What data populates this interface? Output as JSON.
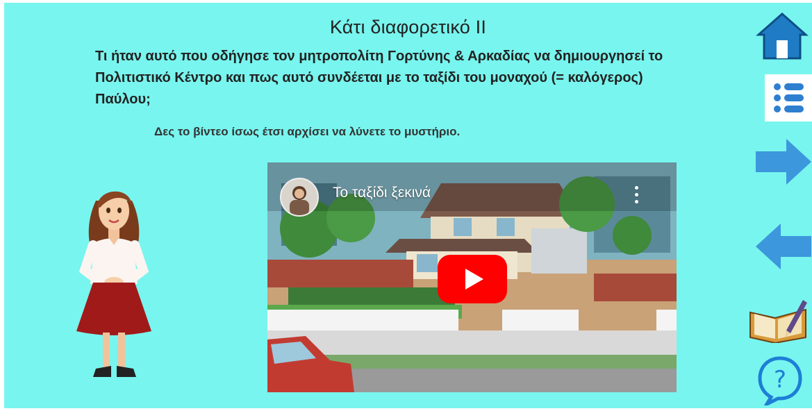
{
  "slide": {
    "title": "Κάτι διαφορετικό ΙΙ",
    "question": "Τι ήταν αυτό που οδήγησε τον μητροπολίτη Γορτύνης & Αρκαδίας να δημιουργησεί το Πολιτιστικό Κέντρο και πως αυτό συνδέεται με το ταξίδι του μοναχού (= καλόγερος) Παύλου;",
    "hint": "Δες το βίντεο ίσως έτσι αρχίσει να λύνετε το μυστήριο."
  },
  "video": {
    "title": "Το ταξίδι ξεκινά"
  },
  "nav": {
    "buttons": [
      "home-icon",
      "menu-list-icon",
      "arrow-right-icon",
      "arrow-left-icon",
      "notebook-icon",
      "help-icon"
    ]
  },
  "colors": {
    "background": "#78f5ee",
    "nav_blue": "#3c97dc",
    "play_red": "#ff0000"
  }
}
